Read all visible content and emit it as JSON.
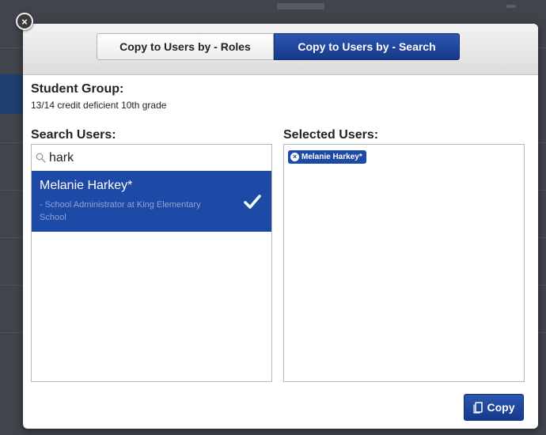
{
  "tabs": {
    "roles_label": "Copy to Users by - Roles",
    "search_label": "Copy to Users by - Search",
    "active": "search"
  },
  "student_group": {
    "label": "Student Group:",
    "name": "13/14 credit deficient 10th grade"
  },
  "search": {
    "label": "Search Users:",
    "value": "hark",
    "results": [
      {
        "name": "Melanie Harkey*",
        "detail": "- School Administrator at King Elementary School",
        "selected": true
      }
    ]
  },
  "selected": {
    "label": "Selected Users:",
    "chips": [
      "Melanie Harkey*"
    ]
  },
  "copy_button": {
    "label": "Copy"
  },
  "icons": {
    "close": "close-icon",
    "search": "search-icon",
    "check": "checkmark-icon",
    "remove": "remove-chip-icon",
    "copy": "copy-icon"
  },
  "colors": {
    "accent": "#1d4aa6",
    "accent_dark": "#16398a",
    "header": "#dcdcdc",
    "overlay": "#40454b"
  }
}
